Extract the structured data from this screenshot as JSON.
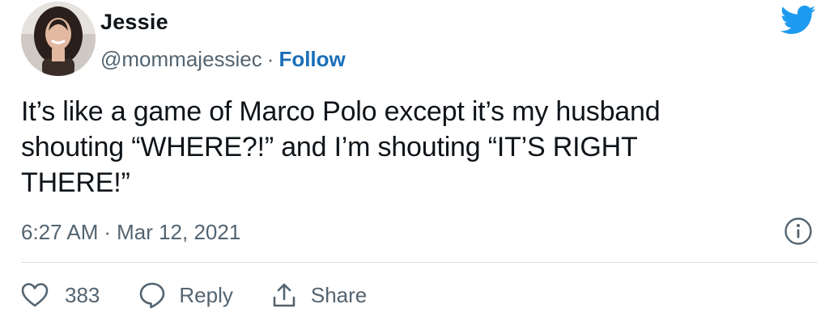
{
  "author": {
    "display_name": "Jessie",
    "handle": "@mommajessiec",
    "separator": "·",
    "follow_label": "Follow"
  },
  "tweet": {
    "text": "It’s like a game of Marco Polo except it’s my husband shouting “WHERE?!” and I’m shouting “IT’S RIGHT THERE!”",
    "time": "6:27 AM",
    "date": "Mar 12, 2021"
  },
  "actions": {
    "like_count": "383",
    "reply_label": "Reply",
    "share_label": "Share"
  },
  "icons": {
    "brand": "twitter-bird-icon",
    "info": "info-icon",
    "like": "heart-icon",
    "reply": "speech-bubble-icon",
    "share": "share-arrow-icon"
  },
  "colors": {
    "brand_blue": "#1d9bf0",
    "follow_blue": "#1b6fb8",
    "text_primary": "#0f1419",
    "text_secondary": "#536471"
  }
}
